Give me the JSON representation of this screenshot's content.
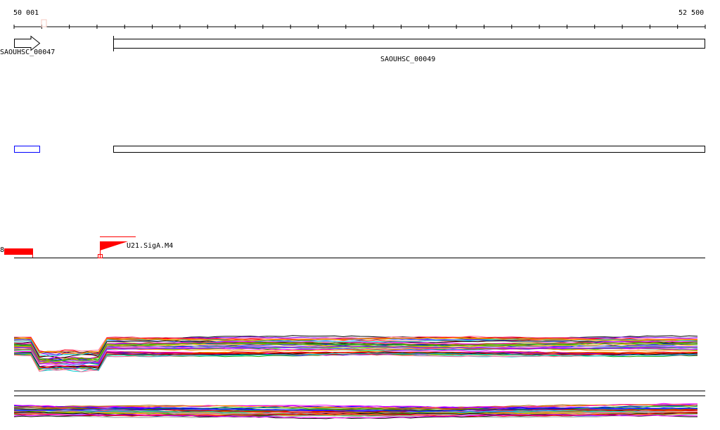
{
  "ruler": {
    "start_label": "50 001",
    "end_label": "52 500",
    "start": 50001,
    "end": 52500,
    "tick_step": 100
  },
  "genes": [
    {
      "name": "SAOUHSC_00047",
      "strand": "+"
    },
    {
      "name": "SAOUHSC_00049",
      "strand": "-"
    }
  ],
  "promoter_track": {
    "left_value": "8",
    "site_label": "U21.SigA.M4"
  },
  "colors": {
    "promoter": "#ff0000",
    "cds_outline": "#0000ff",
    "axis": "#000000"
  },
  "expression_palette": [
    "#000000",
    "#ff0000",
    "#00aa00",
    "#0000ff",
    "#ff00ff",
    "#ff8800",
    "#00cccc",
    "#8800ff",
    "#aa6600",
    "#66cc00",
    "#ff6699",
    "#3366ff",
    "#999999",
    "#cc0000",
    "#ffaa00"
  ]
}
